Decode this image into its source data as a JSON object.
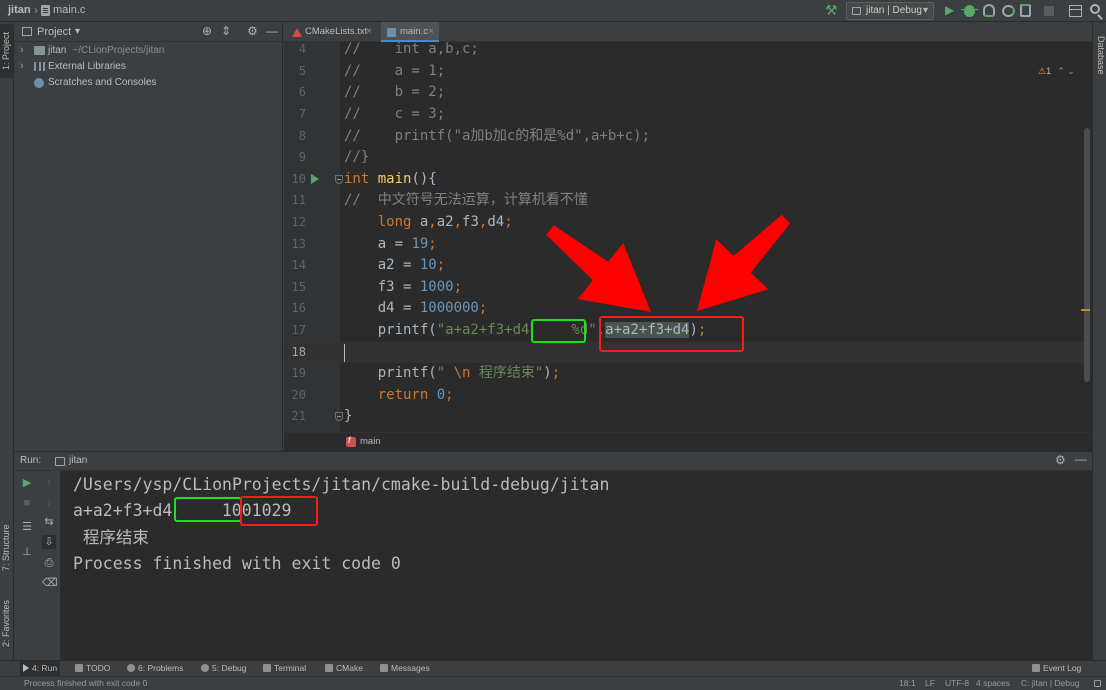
{
  "window": {
    "project_name": "jitan",
    "breadcrumb_sep": "›",
    "file_name": "main.c"
  },
  "toolbar": {
    "run_config": "jitan | Debug",
    "dropdown_glyph": "▾",
    "icons": [
      "hammer-icon",
      "run-icon",
      "debug-icon",
      "coverage-icon",
      "profile-icon",
      "run-more-icon",
      "stop-icon",
      "layout-icon",
      "search-icon"
    ]
  },
  "left_stripe": {
    "project_tab": "1: Project",
    "structure_tab": "7: Structure",
    "favorites_tab": "2: Favorites"
  },
  "right_stripe": {
    "database_tab": "Database"
  },
  "project_panel": {
    "title": "Project",
    "dropdown_glyph": "▾",
    "header_buttons": {
      "locate": "⊕",
      "collapse": "⇕",
      "settings": "⚙",
      "hide": "—"
    },
    "tree": [
      {
        "arrow": "›",
        "label": "jitan",
        "sublabel": "~/CLionProjects/jitan",
        "icon": "folder-icon"
      },
      {
        "arrow": "›",
        "label": "External Libraries",
        "sublabel": "",
        "icon": "library-icon"
      },
      {
        "arrow": "",
        "label": "Scratches and Consoles",
        "sublabel": "",
        "icon": "scratches-icon"
      }
    ]
  },
  "editor": {
    "tabs": [
      {
        "label": "CMakeLists.txt",
        "close": "×",
        "icon": "cmake-icon",
        "active": false
      },
      {
        "label": "main.c",
        "close": "×",
        "icon": "c-file-icon",
        "active": true
      }
    ],
    "inspection": {
      "warning_glyph": "⚠",
      "warning_count": "1",
      "nav": "⌃ ⌄"
    },
    "current_line": 18,
    "lines": [
      {
        "num": 4,
        "tokens": [
          [
            "c",
            "//    int a,b,c;"
          ]
        ]
      },
      {
        "num": 5,
        "tokens": [
          [
            "c",
            "//    a = 1;"
          ]
        ]
      },
      {
        "num": 6,
        "tokens": [
          [
            "c",
            "//    b = 2;"
          ]
        ]
      },
      {
        "num": 7,
        "tokens": [
          [
            "c",
            "//    c = 3;"
          ]
        ]
      },
      {
        "num": 8,
        "tokens": [
          [
            "c",
            "//    printf(\"a加b加c的和是%d\",a+b+c);"
          ]
        ]
      },
      {
        "num": 9,
        "tokens": [
          [
            "c",
            "//}"
          ]
        ]
      },
      {
        "num": 10,
        "run": true,
        "fold": true,
        "tokens": [
          [
            "k",
            "int"
          ],
          [
            "p",
            " "
          ],
          [
            "f",
            "main"
          ],
          [
            "p",
            "(){"
          ]
        ]
      },
      {
        "num": 11,
        "tokens": [
          [
            "c",
            "//  中文符号无法运算，计算机看不懂"
          ]
        ]
      },
      {
        "num": 12,
        "tokens": [
          [
            "p",
            "    "
          ],
          [
            "k",
            "long"
          ],
          [
            "p",
            " a"
          ],
          [
            "k",
            ","
          ],
          [
            "p",
            "a2"
          ],
          [
            "k",
            ","
          ],
          [
            "p",
            "f3"
          ],
          [
            "k",
            ","
          ],
          [
            "p",
            "d4"
          ],
          [
            "k",
            ";"
          ]
        ]
      },
      {
        "num": 13,
        "tokens": [
          [
            "p",
            "    a = "
          ],
          [
            "n",
            "19"
          ],
          [
            "k",
            ";"
          ]
        ]
      },
      {
        "num": 14,
        "tokens": [
          [
            "p",
            "    a2 = "
          ],
          [
            "n",
            "10"
          ],
          [
            "k",
            ";"
          ]
        ]
      },
      {
        "num": 15,
        "tokens": [
          [
            "p",
            "    f3 = "
          ],
          [
            "n",
            "1000"
          ],
          [
            "k",
            ";"
          ]
        ]
      },
      {
        "num": 16,
        "tokens": [
          [
            "p",
            "    d4 = "
          ],
          [
            "n",
            "1000000"
          ],
          [
            "k",
            ";"
          ]
        ]
      },
      {
        "num": 17,
        "tokens": [
          [
            "p",
            "    printf("
          ],
          [
            "s",
            "\"a+a2+f3+d4　　　%d\""
          ],
          [
            "k",
            ","
          ],
          [
            "h",
            "a+a2+f3+d4"
          ],
          [
            "p",
            ")"
          ],
          [
            "k",
            ";"
          ]
        ]
      },
      {
        "num": 18,
        "tokens": []
      },
      {
        "num": 19,
        "tokens": [
          [
            "p",
            "    printf("
          ],
          [
            "s",
            "\" "
          ],
          [
            "e",
            "\\n"
          ],
          [
            "s",
            " 程序结束\""
          ],
          [
            "p",
            ")"
          ],
          [
            "k",
            ";"
          ]
        ]
      },
      {
        "num": 20,
        "tokens": [
          [
            "p",
            "    "
          ],
          [
            "k",
            "return"
          ],
          [
            "p",
            " "
          ],
          [
            "n",
            "0"
          ],
          [
            "k",
            ";"
          ]
        ]
      },
      {
        "num": 21,
        "fold": true,
        "tokens": [
          [
            "p",
            "}"
          ]
        ]
      }
    ],
    "breadcrumb": "main"
  },
  "run_panel": {
    "label": "Run:",
    "tab": "jitan",
    "header_buttons": {
      "settings": "⚙",
      "hide": "—"
    },
    "toolbar_left": {
      "rerun": "▶",
      "stop": "■",
      "layout": "☰",
      "pin": "⊥"
    },
    "toolbar_right": {
      "up": "↑",
      "down": "↓",
      "wrap": "⇆",
      "scroll_end": "⇩",
      "print": "⎙",
      "clear": "⌫"
    },
    "output": [
      "/Users/ysp/CLionProjects/jitan/cmake-build-debug/jitan",
      "a+a2+f3+d4　　　1001029",
      " 程序结束",
      "Process finished with exit code 0"
    ]
  },
  "tool_stripe": {
    "items": [
      {
        "label": "4: Run",
        "icon": "run-icon",
        "active": true
      },
      {
        "label": "TODO",
        "icon": "todo-icon",
        "active": false
      },
      {
        "label": "6: Problems",
        "icon": "problems-icon",
        "active": false
      },
      {
        "label": "5: Debug",
        "icon": "debug-icon",
        "active": false
      },
      {
        "label": "Terminal",
        "icon": "terminal-icon",
        "active": false
      },
      {
        "label": "CMake",
        "icon": "cmake-icon",
        "active": false
      },
      {
        "label": "Messages",
        "icon": "messages-icon",
        "active": false
      }
    ],
    "event_log": "Event Log"
  },
  "status": {
    "message": "Process finished with exit code 0",
    "position": "18:1",
    "line_separator": "LF",
    "encoding": "UTF-8",
    "indent": "4 spaces",
    "context": "C: jitan | Debug"
  },
  "theme": {
    "annotation_green": "#1fe01f",
    "annotation_red": "#ff1a1a",
    "arrow_red": "#ff0000"
  }
}
